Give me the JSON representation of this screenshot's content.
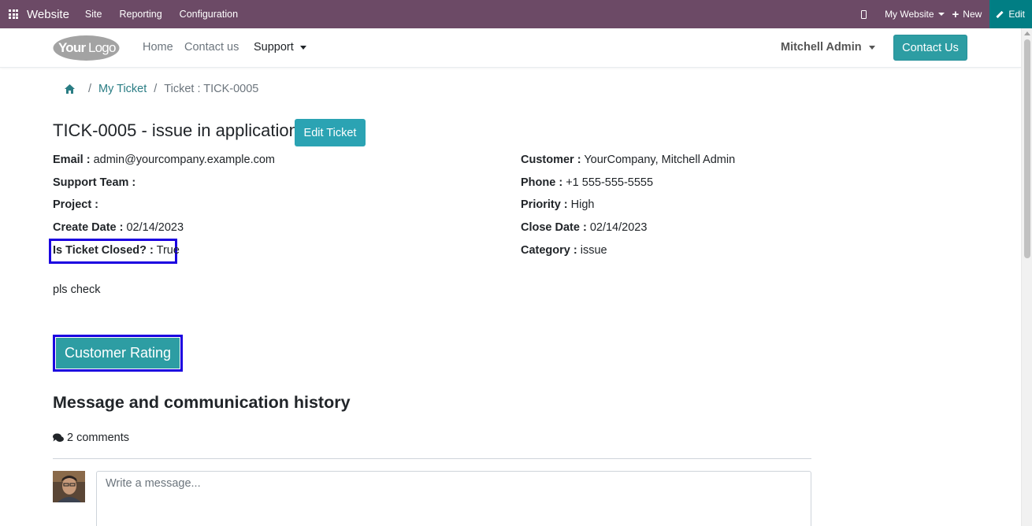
{
  "admin_bar": {
    "brand": "Website",
    "menu": [
      "Site",
      "Reporting",
      "Configuration"
    ],
    "website_switch": "My Website",
    "new_label": "New",
    "edit_label": "Edit"
  },
  "navbar": {
    "logo_text": "YourLogo",
    "links": [
      "Home",
      "Contact us",
      "Support"
    ],
    "user_name": "Mitchell Admin",
    "contact_button": "Contact Us"
  },
  "breadcrumb": {
    "items": [
      "My Ticket",
      "Ticket : TICK-0005"
    ]
  },
  "ticket": {
    "title": "TICK-0005 - issue in application",
    "edit_button": "Edit Ticket",
    "left_fields": [
      {
        "label": "Email :",
        "value": " admin@yourcompany.example.com"
      },
      {
        "label": "Support Team :",
        "value": ""
      },
      {
        "label": "Project :",
        "value": ""
      },
      {
        "label": "Create Date :",
        "value": " 02/14/2023"
      },
      {
        "label": "Is Ticket Closed? :",
        "value": " True"
      }
    ],
    "right_fields": [
      {
        "label": "Customer :",
        "value": " YourCompany, Mitchell Admin"
      },
      {
        "label": "Phone :",
        "value": " +1 555-555-5555"
      },
      {
        "label": "Priority :",
        "value": " High"
      },
      {
        "label": "Close Date :",
        "value": " 02/14/2023"
      },
      {
        "label": "Category :",
        "value": " issue"
      }
    ],
    "description": "pls check",
    "rating_button": "Customer Rating"
  },
  "history": {
    "title": "Message and communication history",
    "comments_count": "2 comments",
    "message_placeholder": "Write a message..."
  },
  "colors": {
    "admin_bar": "#6c4a66",
    "accent": "#2d9da3",
    "highlight": "#1b00e0"
  }
}
